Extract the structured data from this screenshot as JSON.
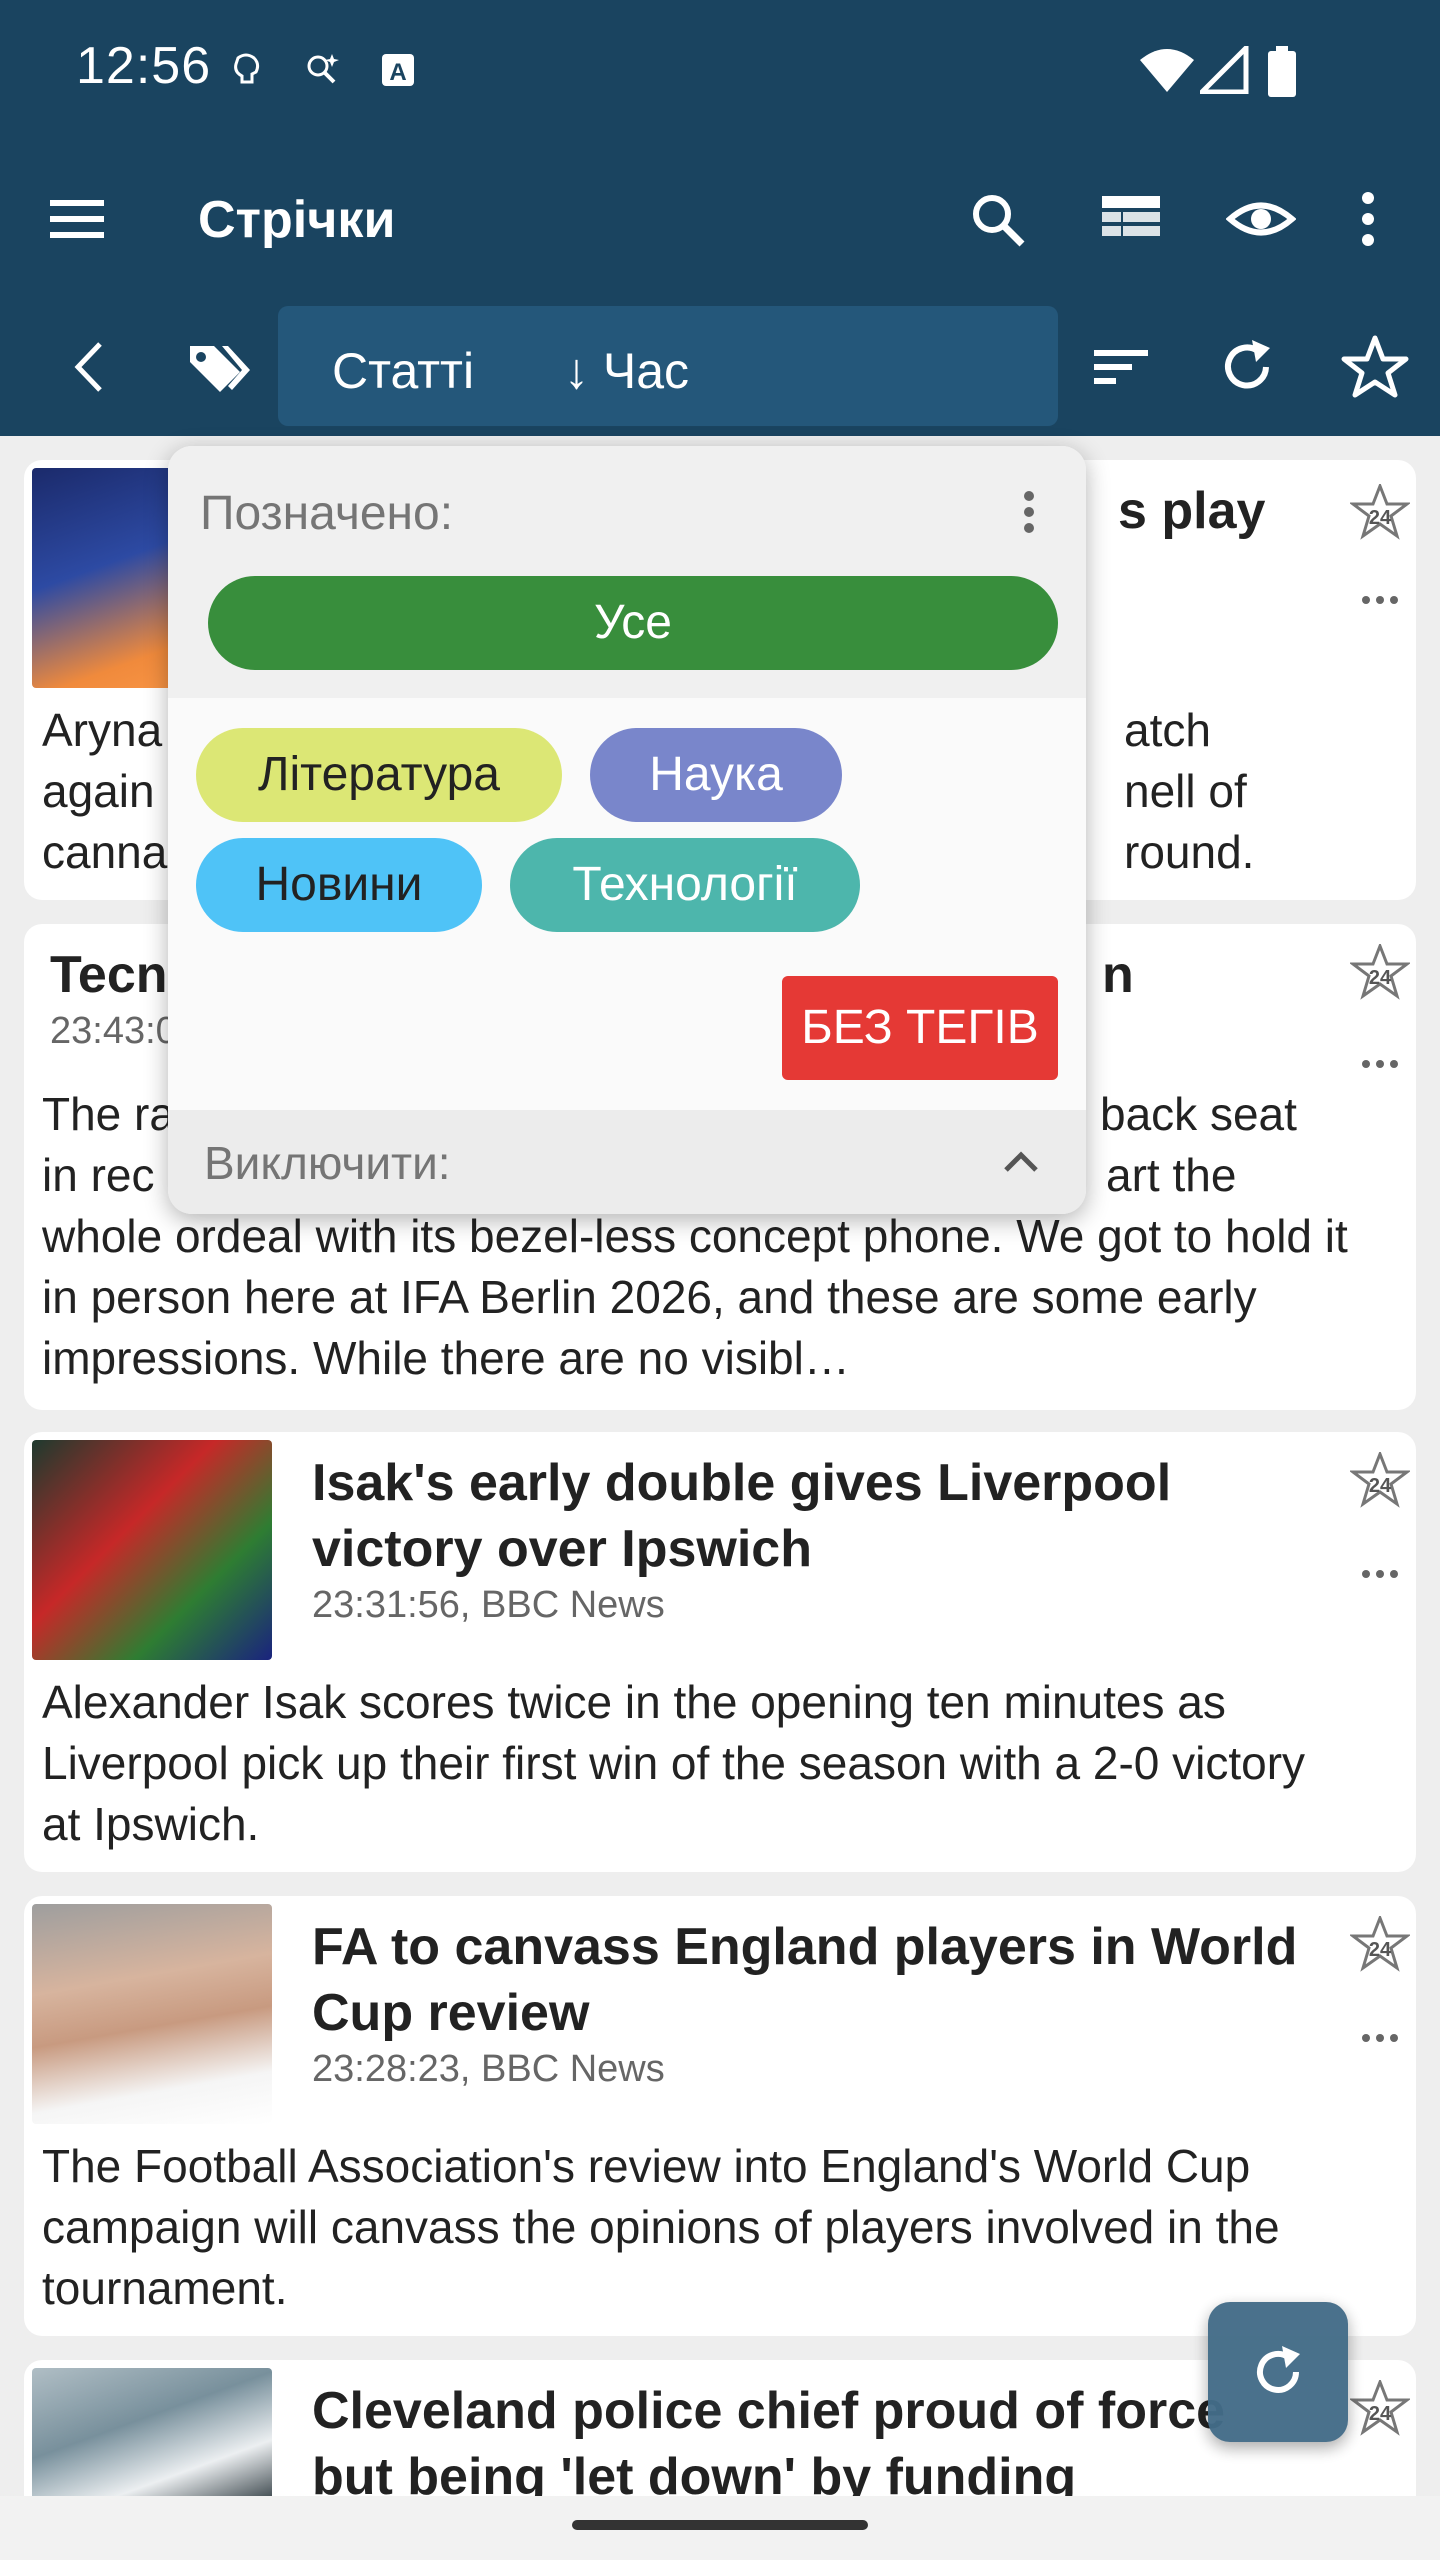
{
  "status_bar": {
    "time": "12:56"
  },
  "toolbar": {
    "title": "Стрічки"
  },
  "subbar": {
    "type_label": "Статті",
    "sort_label": "↓ Час"
  },
  "popup": {
    "marked_label": "Позначено:",
    "all_button": "Усе",
    "tags": [
      {
        "label": "Література",
        "color": "#dce775",
        "text_color": "#222222"
      },
      {
        "label": "Наука",
        "color": "#7986cb",
        "text_color": "#ffffff"
      },
      {
        "label": "Новини",
        "color": "#4fc3f7",
        "text_color": "#222222"
      },
      {
        "label": "Технології",
        "color": "#4db6ac",
        "text_color": "#ffffff"
      }
    ],
    "no_tags_button": "БЕЗ ТЕГІВ",
    "exclude_label": "Виключити:"
  },
  "articles": [
    {
      "title_visible": "s play",
      "body_lines": [
        "Aryna",
        "atch",
        "again",
        "nell of",
        "canna",
        "round."
      ]
    },
    {
      "title_visible_left": "Tecn",
      "title_visible_right": "n",
      "meta_visible": "23:43:0",
      "body": "The ra back seat in rec art the whole ordeal with its bezel-less concept phone. We got to hold it in person here at IFA Berlin 2026, and these are some early impressions. While there are no visibl…",
      "body_left_1": "The ra",
      "body_right_1": "back seat",
      "body_left_2": "in rec",
      "body_right_2": "art the",
      "body_rest": "whole ordeal with its bezel-less concept phone. We got to hold it in person here at IFA Berlin 2026, and these are some early impressions. While there are no visibl…"
    },
    {
      "title": "Isak's early double gives Liverpool victory over Ipswich",
      "meta": "23:31:56, BBC News",
      "body": "Alexander Isak scores twice in the opening ten minutes as Liverpool pick up their first win of the season with a 2-0 victory at Ipswich."
    },
    {
      "title": "FA to canvass England players in World Cup review",
      "meta": "23:28:23, BBC News",
      "body": "The Football Association's review into England's World Cup campaign will canvass the opinions of players involved in the tournament."
    },
    {
      "title": "Cleveland police chief proud of force but being 'let down' by funding"
    }
  ],
  "colors": {
    "app_bar": "#1a4460",
    "accent_green": "#388e3c",
    "no_tag_red": "#e53935"
  }
}
